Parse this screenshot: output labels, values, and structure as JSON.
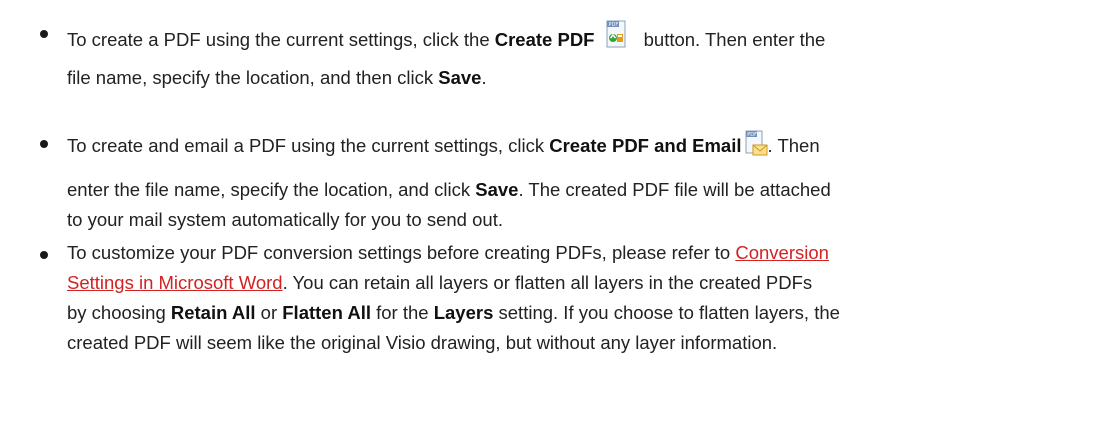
{
  "items": [
    {
      "lines": [
        [
          "To create a PDF using the current settings, click the ",
          {
            "b": "Create PDF"
          },
          {
            "icon": "create-pdf-icon"
          },
          " button. Then enter the"
        ],
        [
          "file name, specify the location, and then click ",
          {
            "b": "Save"
          },
          "."
        ]
      ]
    },
    {
      "lines": [
        [
          "To create and email a PDF using the current settings, click ",
          {
            "b": "Create PDF and Email"
          },
          {
            "icon": "create-pdf-email-icon"
          },
          ". Then"
        ],
        [
          "enter the file name, specify the location, and click ",
          {
            "b": "Save"
          },
          ". The created PDF file will be attached"
        ],
        [
          "to your mail system automatically for you to send out."
        ]
      ]
    },
    {
      "lines": [
        [
          "To customize your PDF conversion settings before creating PDFs, please refer to ",
          {
            "link": "Conversion"
          }
        ],
        [
          {
            "link": "Settings in Microsoft Word"
          },
          ". You can retain all layers or flatten all layers in the created PDFs"
        ],
        [
          "by choosing ",
          {
            "b": "Retain All"
          },
          " or ",
          {
            "b": "Flatten All"
          },
          " for the ",
          {
            "b": "Layers"
          },
          " setting. If you choose to flatten layers, the"
        ],
        [
          "created PDF will seem like the original Visio drawing, but without any layer information."
        ]
      ]
    }
  ]
}
